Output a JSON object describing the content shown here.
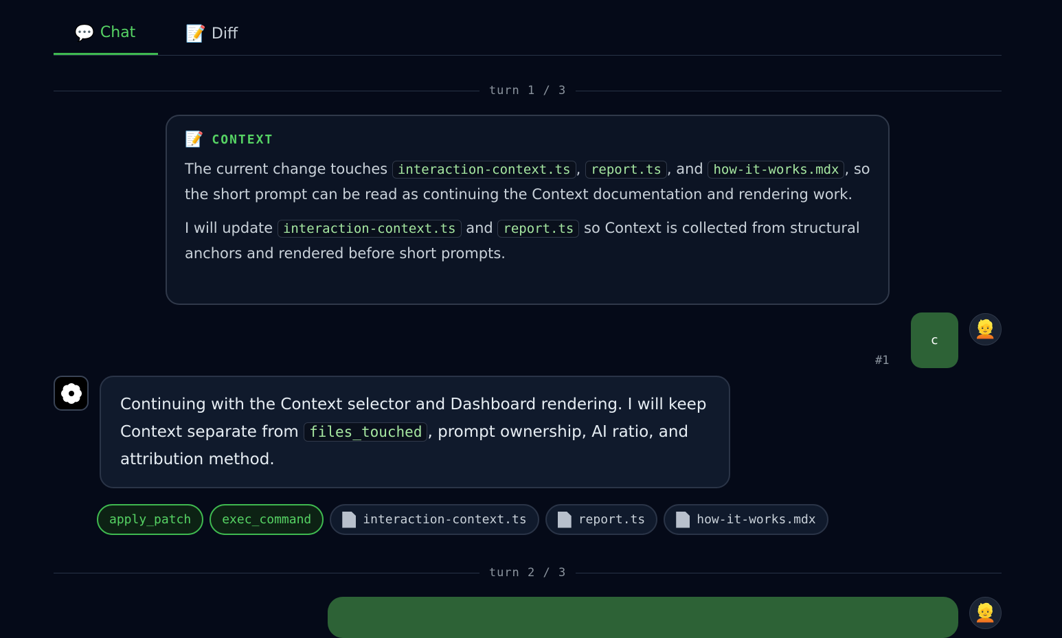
{
  "tabs": [
    {
      "icon": "💬",
      "label": "Chat",
      "active": true
    },
    {
      "icon": "📝",
      "label": "Diff",
      "active": false
    }
  ],
  "turns": [
    {
      "label": "turn 1 / 3"
    },
    {
      "label": "turn 2 / 3"
    }
  ],
  "context": {
    "icon": "📝",
    "title": "CONTEXT",
    "p1": {
      "t1": "The current change touches ",
      "c1": "interaction-context.ts",
      "t2": ", ",
      "c2": "report.ts",
      "t3": ", and ",
      "c3": "how-it-works.mdx",
      "t4": ", so the short prompt can be read as continuing the Context documentation and rendering work."
    },
    "p2": {
      "t1": "I will update ",
      "c1": "interaction-context.ts",
      "t2": " and ",
      "c2": "report.ts",
      "t3": " so Context is collected from structural anchors and rendered before short prompts."
    }
  },
  "user_message": {
    "text": "c",
    "index": "#1",
    "avatar": "👱"
  },
  "assistant_message": {
    "t1": "Continuing with the Context selector and Dashboard rendering. I will keep Context separate from ",
    "c1": "files_touched",
    "t2": ", prompt ownership, AI ratio, and attribution method."
  },
  "tools": [
    "apply_patch",
    "exec_command"
  ],
  "files": [
    "interaction-context.ts",
    "report.ts",
    "how-it-works.mdx"
  ],
  "colors": {
    "background": "#050a18",
    "accent": "#3fb950",
    "user_bubble": "#2d6236"
  }
}
